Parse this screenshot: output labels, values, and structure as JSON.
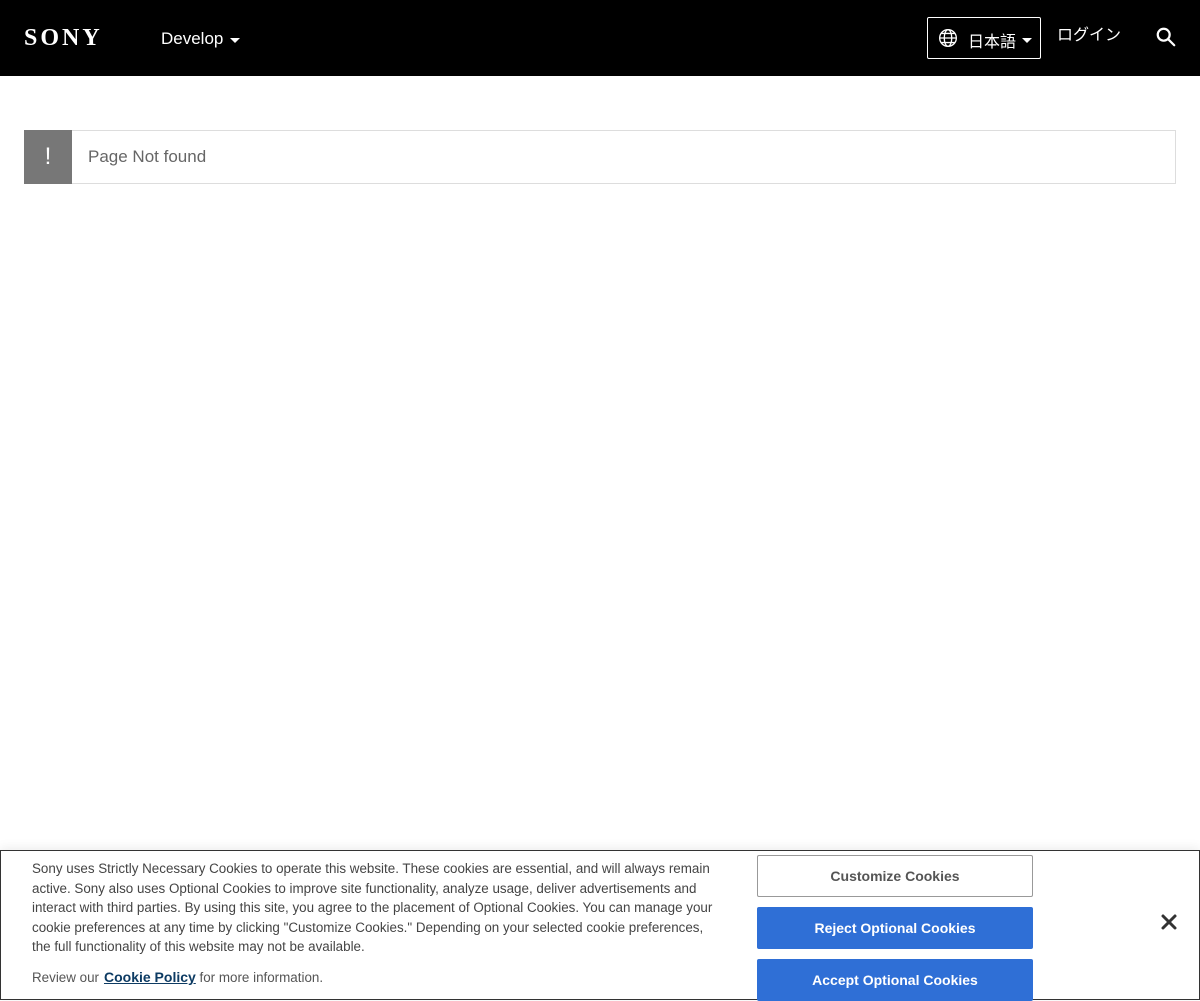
{
  "header": {
    "logo": "SONY",
    "nav_develop": "Develop",
    "language": "日本語",
    "login": "ログイン"
  },
  "alert": {
    "icon": "!",
    "message": "Page Not found"
  },
  "cookie": {
    "body": "Sony uses Strictly Necessary Cookies to operate this website. These cookies are essential, and will always remain active. Sony also uses Optional Cookies to improve site functionality, analyze usage, deliver advertisements and interact with third parties. By using this site, you agree to the placement of Optional Cookies. You can manage your cookie preferences at any time by clicking \"Customize Cookies.\" Depending on your selected cookie preferences, the full functionality of this website may not be available.",
    "review_prefix": "Review our",
    "policy_link": "Cookie Policy",
    "review_suffix": " for more information.",
    "customize": "Customize Cookies",
    "reject": "Reject Optional Cookies",
    "accept": "Accept Optional Cookies"
  },
  "icons": {
    "globe": "globe-icon",
    "search": "search-icon",
    "close": "close-icon",
    "caret": "chevron-down-icon"
  },
  "colors": {
    "header_bg": "#000000",
    "alert_icon_bg": "#777777",
    "primary_button": "#2f6fd6",
    "link": "#0d3b63"
  }
}
